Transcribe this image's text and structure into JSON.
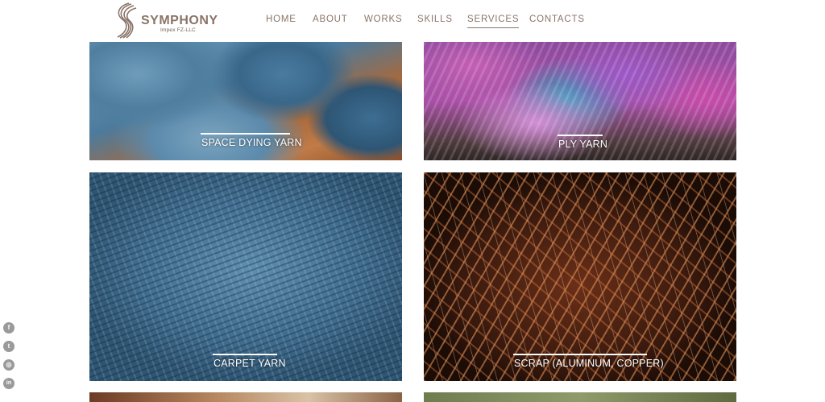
{
  "brand": {
    "name": "SYMPHONY",
    "tagline": "Impex FZ-LLC"
  },
  "nav": {
    "items": [
      {
        "label": "HOME"
      },
      {
        "label": "ABOUT"
      },
      {
        "label": "WORKS"
      },
      {
        "label": "SKILLS"
      },
      {
        "label": "SERVICES",
        "active": true
      },
      {
        "label": "CONTACTS"
      }
    ]
  },
  "tiles": [
    {
      "caption": "SPACE DYING YARN"
    },
    {
      "caption": "PLY YARN"
    },
    {
      "caption": "CARPET YARN"
    },
    {
      "caption": "SCRAP (ALUMINUM, COPPER)"
    }
  ],
  "social": [
    {
      "icon": "facebook-icon",
      "glyph": "f"
    },
    {
      "icon": "twitter-icon",
      "glyph": "t"
    },
    {
      "icon": "instagram-icon",
      "glyph": "◎"
    },
    {
      "icon": "linkedin-icon",
      "glyph": "in"
    }
  ],
  "colors": {
    "nav_text": "#8a7468",
    "social_bg": "#9a9a9a"
  }
}
